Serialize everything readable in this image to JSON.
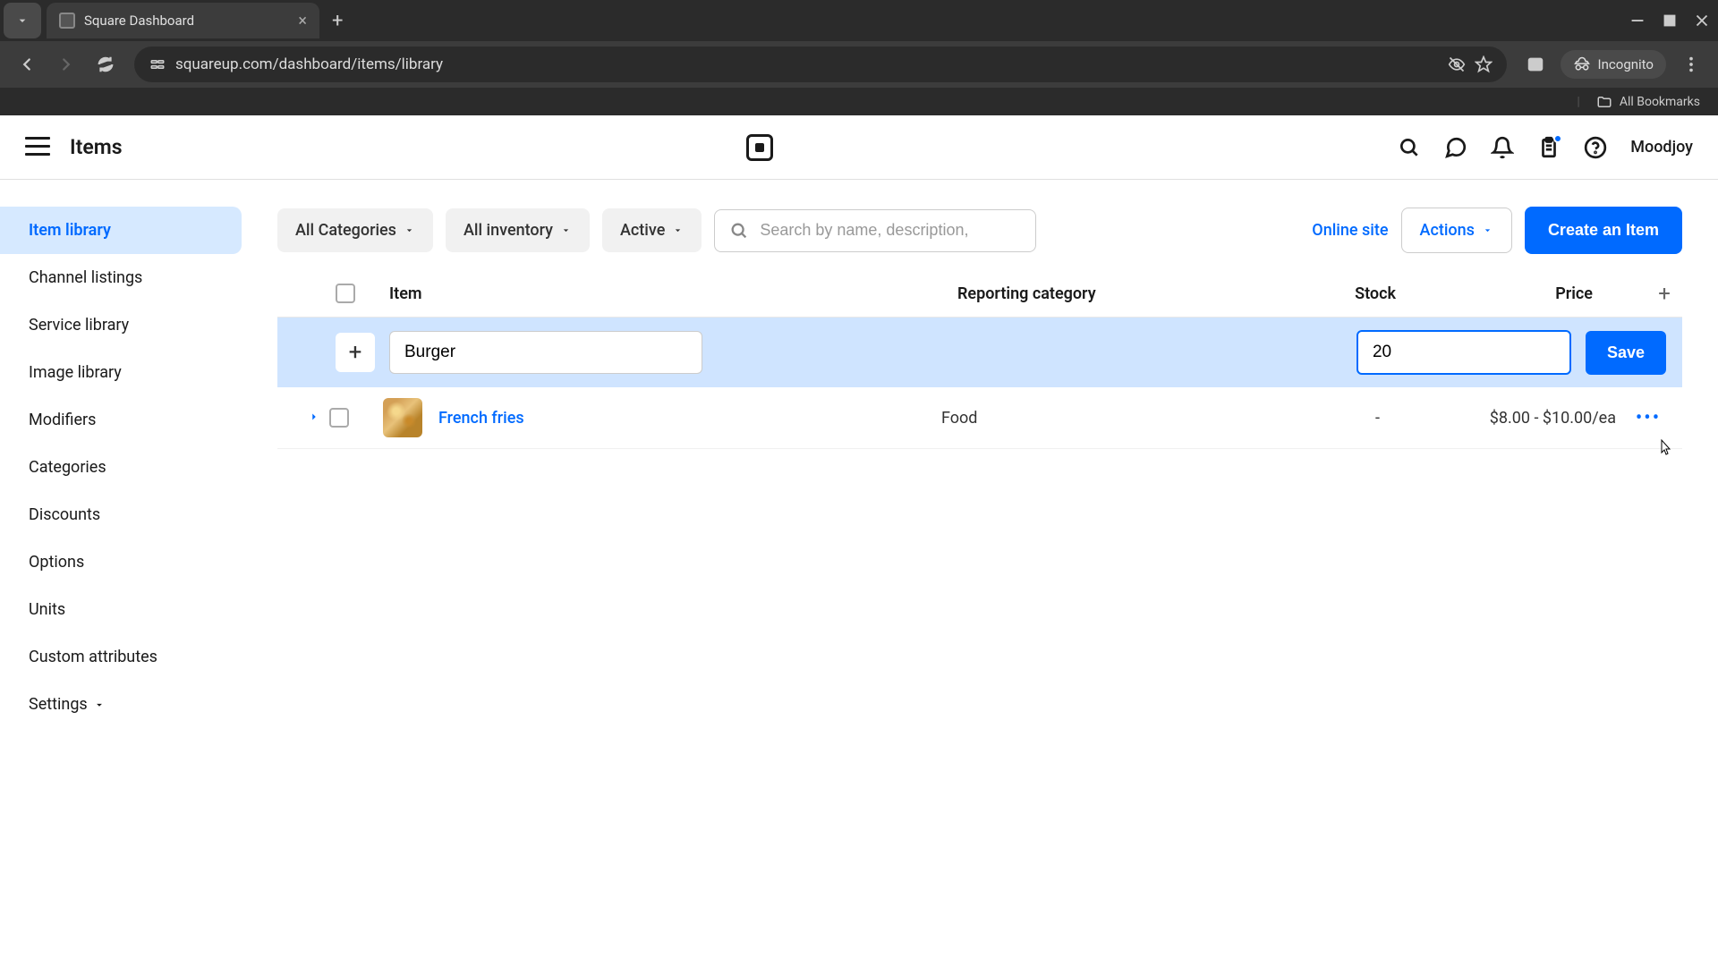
{
  "browser": {
    "tab_title": "Square Dashboard",
    "url": "squareup.com/dashboard/items/library",
    "incognito_label": "Incognito",
    "all_bookmarks": "All Bookmarks"
  },
  "header": {
    "page_title": "Items",
    "user_name": "Moodjoy"
  },
  "sidebar": {
    "items": [
      {
        "label": "Item library",
        "active": true
      },
      {
        "label": "Channel listings"
      },
      {
        "label": "Service library"
      },
      {
        "label": "Image library"
      },
      {
        "label": "Modifiers"
      },
      {
        "label": "Categories"
      },
      {
        "label": "Discounts"
      },
      {
        "label": "Options"
      },
      {
        "label": "Units"
      },
      {
        "label": "Custom attributes"
      },
      {
        "label": "Settings",
        "has_chevron": true
      }
    ]
  },
  "toolbar": {
    "filters": {
      "categories": "All Categories",
      "inventory": "All inventory",
      "status": "Active"
    },
    "search_placeholder": "Search by name, description,",
    "online_site": "Online site",
    "actions": "Actions",
    "create_item": "Create an Item"
  },
  "table": {
    "columns": {
      "item": "Item",
      "reporting_category": "Reporting category",
      "stock": "Stock",
      "price": "Price"
    },
    "edit_row": {
      "name_value": "Burger",
      "price_value": "20",
      "save_label": "Save"
    },
    "rows": [
      {
        "name": "French fries",
        "category": "Food",
        "stock": "-",
        "price": "$8.00 - $10.00/ea"
      }
    ]
  }
}
